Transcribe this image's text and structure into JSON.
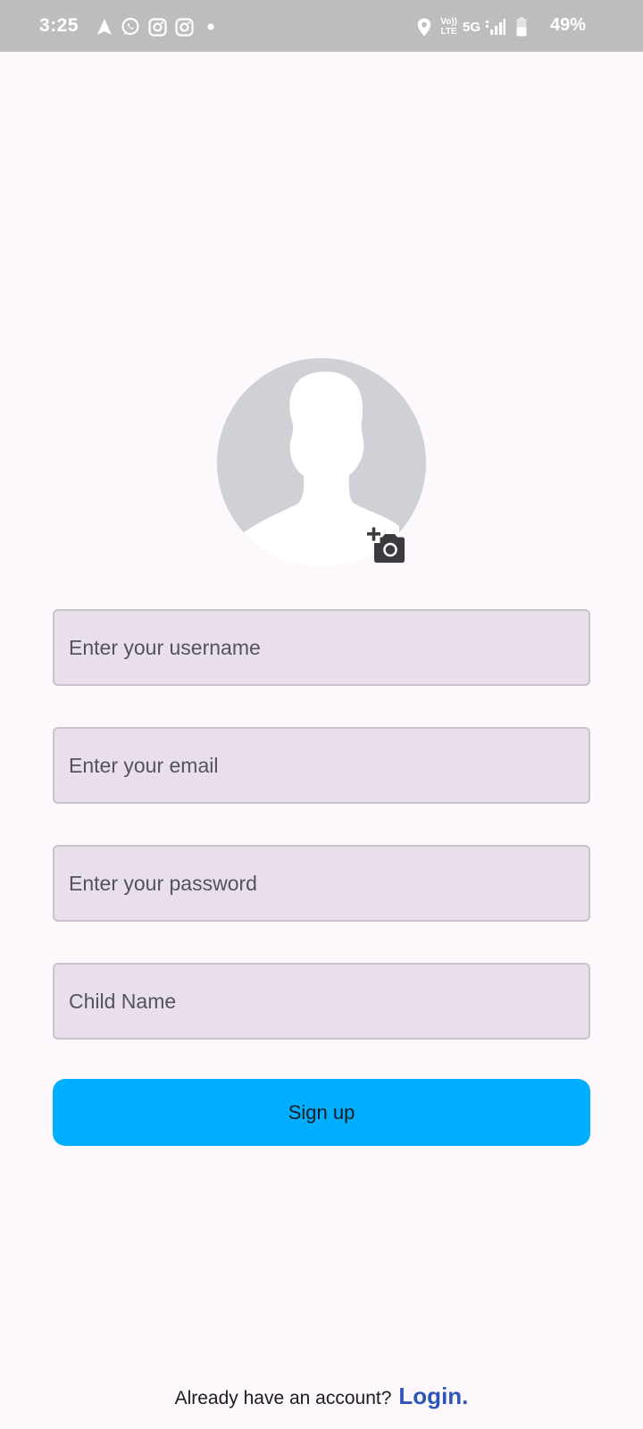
{
  "status_bar": {
    "time": "3:25",
    "left_icons": [
      "navigation-arrow-icon",
      "whatsapp-icon",
      "instagram-icon",
      "instagram-icon",
      "notification-dot-icon"
    ],
    "right_icons": [
      "location-pin-icon",
      "volte-icon",
      "5g-icon",
      "signal-icon",
      "battery-icon"
    ],
    "volte_line1": "Vo))",
    "volte_line2": "LTE",
    "network": "5G",
    "battery": "49%",
    "background": "#bdbcbe"
  },
  "profile": {
    "avatar_icon": "default-avatar-icon",
    "camera_icon": "add-photo-camera-icon"
  },
  "form": {
    "username_placeholder": "Enter your username",
    "email_placeholder": "Enter your email",
    "password_placeholder": "Enter your password",
    "child_name_placeholder": "Child Name",
    "field_background": "#e8dfea"
  },
  "signup": {
    "label": "Sign up",
    "color": "#00aeff"
  },
  "footer": {
    "prompt": "Already have an account?",
    "login_label": "Login.",
    "login_color": "#2e55b8"
  }
}
